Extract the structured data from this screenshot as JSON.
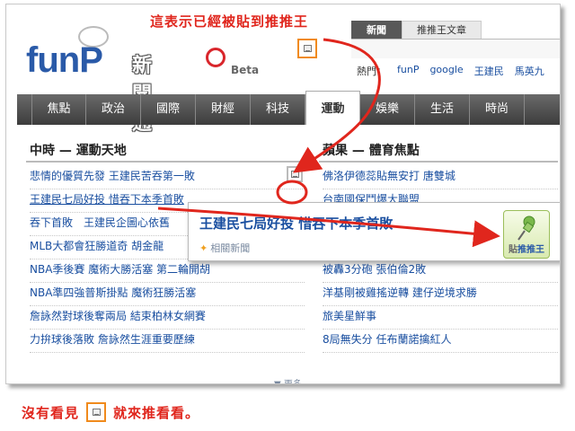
{
  "annotations": {
    "top_note": "這表示已經被貼到推推王",
    "bottom_note_before": "沒有看見",
    "bottom_note_after": "就來推看看。"
  },
  "logo": {
    "brand": "funP",
    "product": "新聞通",
    "tag": "Beta"
  },
  "top_tabs": [
    {
      "label": "新聞",
      "active": true
    },
    {
      "label": "推推王文章",
      "active": false
    }
  ],
  "hot": {
    "label": "熱門：",
    "links": [
      "funP",
      "google",
      "王建民",
      "馬英九"
    ]
  },
  "nav": {
    "items": [
      "焦點",
      "政治",
      "國際",
      "財經",
      "科技",
      "運動",
      "娛樂",
      "生活",
      "時尚"
    ],
    "active_index": 5
  },
  "left_column": {
    "title": "中時 — 運動天地",
    "items": [
      "悲情的優質先發 王建民苦吞第一敗",
      "王建民七局好投 惜吞下本季首敗",
      "吞下首敗　王建民企圖心依舊",
      "MLB大都會狂勝道奇 胡金龍",
      "NBA季後賽 魔術大勝活塞 第二輪開胡",
      "NBA準四強普斯掛點 魔術狂勝活塞",
      "詹詠然對球後奪兩局 結束柏林女網賽",
      "力拚球後落敗 詹詠然生涯重要歷練"
    ]
  },
  "right_column": {
    "title": "蘋果 — 體育焦點",
    "items": [
      "佛洛伊德蕊貼無安打 唐雙城",
      "台南國保鬥爆大聯盟",
      "",
      "",
      "被轟3分砲 張伯倫2敗",
      "洋基剛被雞搖逆轉 建仔逆境求勝",
      "旅美星鮮事",
      "8局無失分 任布蘭諾擒紅人"
    ]
  },
  "popup": {
    "title": "王建民七局好投 惜吞下本季首敗",
    "related": "相關新聞",
    "push_label_prefix": "貼",
    "push_label": "推推王"
  },
  "more": "▼ 更多",
  "colors": {
    "annotation_red": "#e0261d",
    "marker_orange": "#f08a1c",
    "link_blue": "#1a4fa0"
  }
}
